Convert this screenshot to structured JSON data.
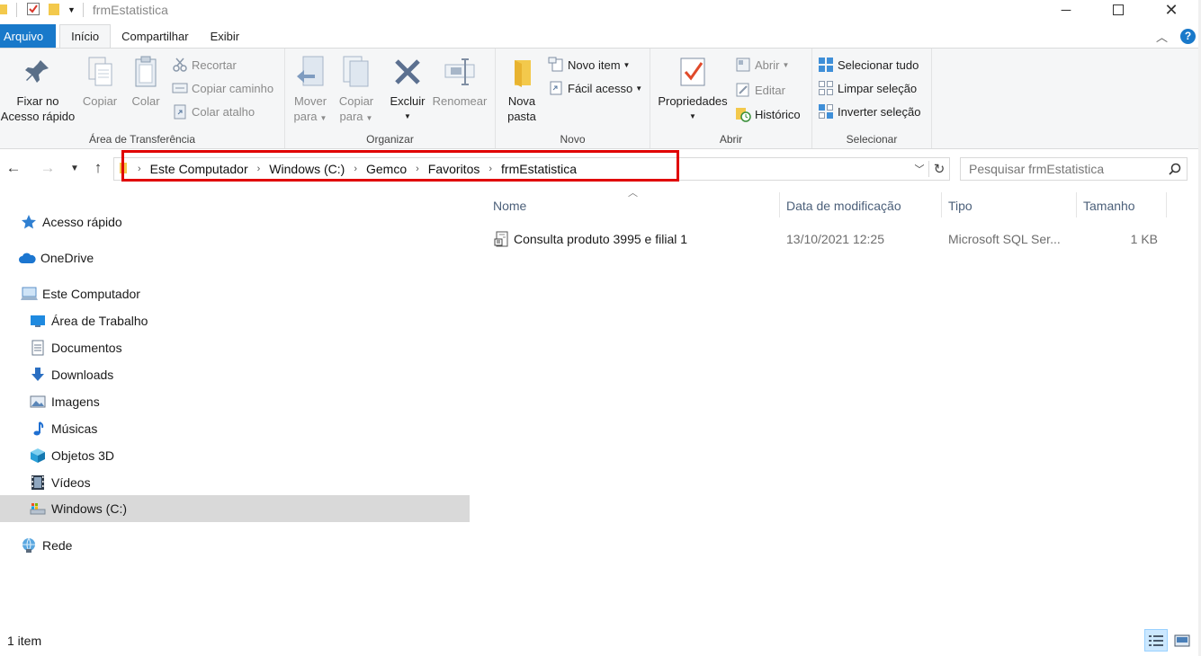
{
  "window": {
    "title": "frmEstatistica"
  },
  "ribbon_tabs": {
    "file": "Arquivo",
    "home": "Início",
    "share": "Compartilhar",
    "view": "Exibir"
  },
  "ribbon": {
    "clipboard": {
      "label": "Área de Transferência",
      "pin_line1": "Fixar no",
      "pin_line2": "Acesso rápido",
      "copy": "Copiar",
      "paste": "Colar",
      "cut": "Recortar",
      "copy_path": "Copiar caminho",
      "paste_shortcut": "Colar atalho"
    },
    "organize": {
      "label": "Organizar",
      "move_line1": "Mover",
      "move_line2": "para",
      "copy_line1": "Copiar",
      "copy_line2": "para",
      "delete": "Excluir",
      "rename": "Renomear"
    },
    "new": {
      "label": "Novo",
      "folder_line1": "Nova",
      "folder_line2": "pasta",
      "new_item": "Novo item",
      "easy_access": "Fácil acesso"
    },
    "open": {
      "label": "Abrir",
      "properties": "Propriedades",
      "open": "Abrir",
      "edit": "Editar",
      "history": "Histórico"
    },
    "select": {
      "label": "Selecionar",
      "select_all": "Selecionar tudo",
      "select_none": "Limpar seleção",
      "invert": "Inverter seleção"
    }
  },
  "address": {
    "crumbs": [
      "Este Computador",
      "Windows (C:)",
      "Gemco",
      "Favoritos",
      "frmEstatistica"
    ],
    "search_placeholder": "Pesquisar frmEstatistica"
  },
  "nav_pane": {
    "quick_access": "Acesso rápido",
    "onedrive": "OneDrive",
    "this_pc": "Este Computador",
    "desktop": "Área de Trabalho",
    "documents": "Documentos",
    "downloads": "Downloads",
    "pictures": "Imagens",
    "music": "Músicas",
    "objects3d": "Objetos 3D",
    "videos": "Vídeos",
    "drive_c": "Windows (C:)",
    "network": "Rede"
  },
  "columns": {
    "name": "Nome",
    "date": "Data de modificação",
    "type": "Tipo",
    "size": "Tamanho"
  },
  "files": [
    {
      "name": "Consulta produto 3995 e filial 1",
      "date": "13/10/2021 12:25",
      "type": "Microsoft SQL Ser...",
      "size": "1 KB"
    }
  ],
  "status": {
    "count": "1 item"
  },
  "colors": {
    "accent": "#1979ca",
    "highlight_box": "#e00000",
    "ribbon_bg": "#f5f6f7",
    "selected_nav": "#d9d9d9",
    "column_header": "#4c607a"
  }
}
